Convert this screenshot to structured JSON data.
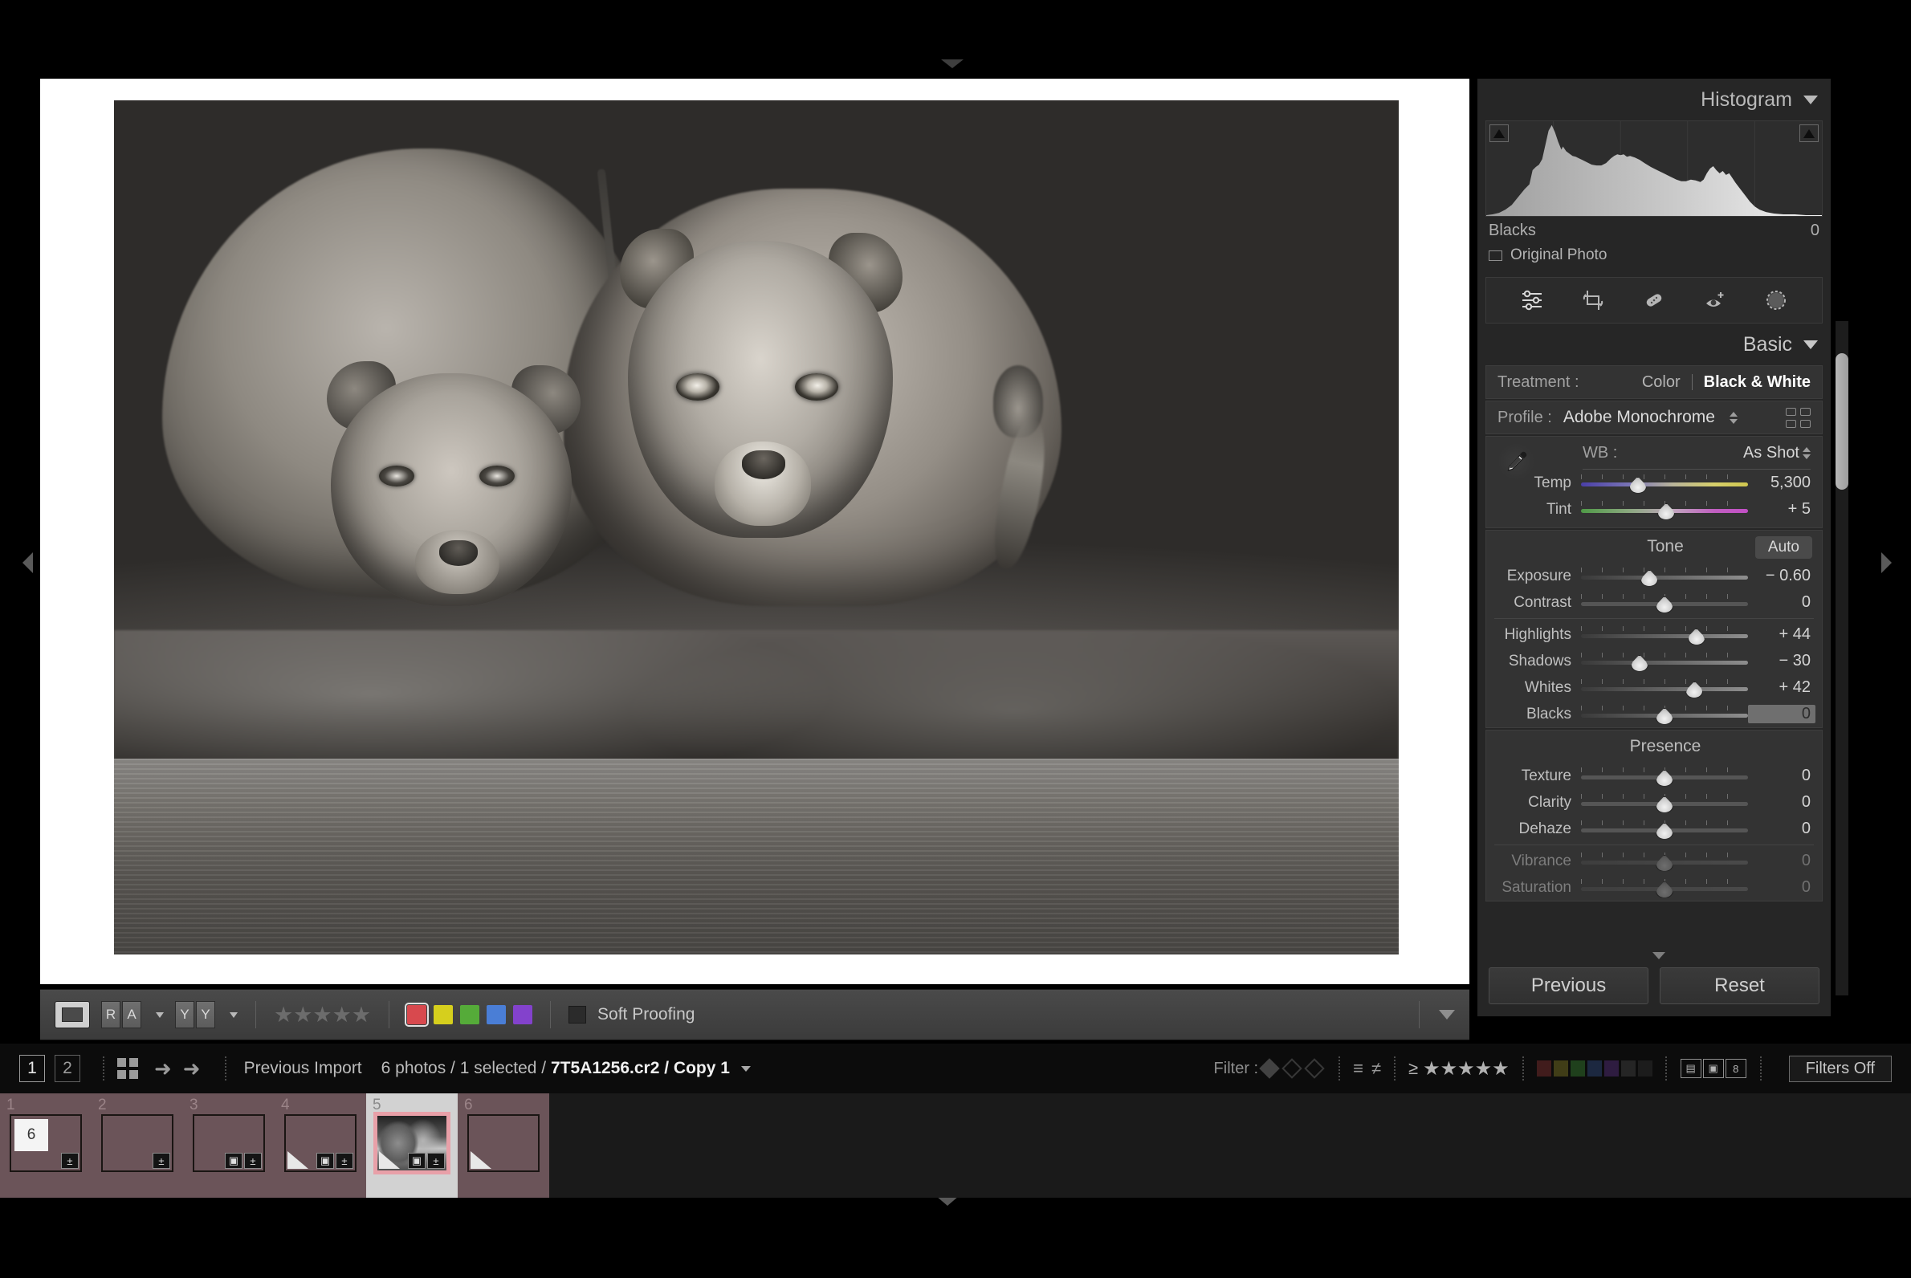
{
  "right_panel": {
    "histogram": {
      "title": "Histogram",
      "collapse_icon": "chevron-down-icon",
      "readout_label": "Blacks",
      "readout_value": "0",
      "original_photo_label": "Original Photo",
      "clip_left_icon": "shadow-clipping-triangle-icon",
      "clip_right_icon": "highlight-clipping-triangle-icon"
    },
    "tools": [
      {
        "name": "edit-sliders-icon",
        "title": "Edit"
      },
      {
        "name": "crop-overlay-icon",
        "title": "Crop"
      },
      {
        "name": "spot-removal-icon",
        "title": "Healing"
      },
      {
        "name": "red-eye-icon",
        "title": "Red Eye"
      },
      {
        "name": "masking-icon",
        "title": "Masking"
      }
    ],
    "basic": {
      "title": "Basic",
      "collapse_icon": "chevron-down-icon",
      "treatment_label": "Treatment :",
      "treatment_options": [
        "Color",
        "Black & White"
      ],
      "treatment_selected": "Black & White",
      "profile_label": "Profile :",
      "profile_value": "Adobe Monochrome",
      "profile_browser_icon": "grid-2x2-icon",
      "wb_label": "WB :",
      "wb_value": "As Shot",
      "eyedropper_icon": "eyedropper-icon",
      "white_balance_sliders": [
        {
          "label": "Temp",
          "value": "5,300",
          "pos": 34,
          "style": "temp",
          "dim": false
        },
        {
          "label": "Tint",
          "value": "+ 5",
          "pos": 51,
          "style": "tint",
          "dim": false
        }
      ],
      "tone_title": "Tone",
      "auto_label": "Auto",
      "tone_sliders": [
        {
          "label": "Exposure",
          "value": "− 0.60",
          "pos": 41,
          "style": "tonal",
          "dim": false
        },
        {
          "label": "Contrast",
          "value": "0",
          "pos": 50,
          "style": "flat",
          "dim": false
        },
        {
          "label": "Highlights",
          "value": "+ 44",
          "pos": 69,
          "style": "tonal",
          "dim": false
        },
        {
          "label": "Shadows",
          "value": "− 30",
          "pos": 35,
          "style": "tonal",
          "dim": false
        },
        {
          "label": "Whites",
          "value": "+ 42",
          "pos": 68,
          "style": "tonal",
          "dim": false
        },
        {
          "label": "Blacks",
          "value": "0",
          "pos": 50,
          "style": "tonal",
          "dim": false,
          "boxed": true
        }
      ],
      "presence_title": "Presence",
      "presence_sliders": [
        {
          "label": "Texture",
          "value": "0",
          "pos": 50,
          "style": "flat",
          "dim": false
        },
        {
          "label": "Clarity",
          "value": "0",
          "pos": 50,
          "style": "flat",
          "dim": false
        },
        {
          "label": "Dehaze",
          "value": "0",
          "pos": 50,
          "style": "flat",
          "dim": false
        },
        {
          "label": "Vibrance",
          "value": "0",
          "pos": 50,
          "style": "dimmed",
          "dim": true
        },
        {
          "label": "Saturation",
          "value": "0",
          "pos": 50,
          "style": "dimmed",
          "dim": true
        }
      ]
    },
    "footer": {
      "previous_label": "Previous",
      "reset_label": "Reset"
    }
  },
  "image_toolbar": {
    "loupe_icon": "loupe-view-icon",
    "flag_pair": [
      "R",
      "A"
    ],
    "compare_pair": [
      "Y",
      "Y"
    ],
    "stars": "★★★★★",
    "color_swatches": [
      {
        "name": "red-label",
        "hex": "#d8494e",
        "selected": true
      },
      {
        "name": "yellow-label",
        "hex": "#d6cf1d",
        "selected": false
      },
      {
        "name": "green-label",
        "hex": "#55ab39",
        "selected": false
      },
      {
        "name": "blue-label",
        "hex": "#4a7ed6",
        "selected": false
      },
      {
        "name": "purple-label",
        "hex": "#8342cc",
        "selected": false
      }
    ],
    "soft_proofing_label": "Soft Proofing",
    "soft_proofing_checked": false,
    "toolbar_caret_icon": "chevron-down-icon"
  },
  "filmstrip_bar": {
    "view_1": "1",
    "view_2": "2",
    "grid_icon": "grid-view-icon",
    "back_icon": "arrow-left-icon",
    "forward_icon": "arrow-right-icon",
    "source": "Previous Import",
    "count_text": "6 photos / 1 selected /",
    "filename": "7T5A1256.cr2 / Copy 1",
    "filter_label": "Filter :",
    "filter_stars_prefix": "≥",
    "filter_stars": "★★★★★",
    "filter_colors": [
      "#6e2a2a",
      "#6b6620",
      "#2f6b2a",
      "#2a3f6b",
      "#4a2a6b",
      "#3a3a3a",
      "#2a2a2a"
    ],
    "view_icons": [
      "metadata-view-icon",
      "loupe-view-icon",
      "numbers-view-icon"
    ],
    "filters_off_label": "Filters Off"
  },
  "filmstrip": {
    "thumbnails": [
      {
        "num": "1",
        "mono": false,
        "selected": false,
        "badges": [
          "±"
        ],
        "has_corner_flag": false,
        "overlay_number": "6"
      },
      {
        "num": "2",
        "mono": false,
        "selected": false,
        "badges": [
          "±"
        ],
        "has_corner_flag": false,
        "overlay_number": ""
      },
      {
        "num": "3",
        "mono": false,
        "selected": false,
        "badges": [
          "▣",
          "±"
        ],
        "has_corner_flag": false,
        "overlay_number": ""
      },
      {
        "num": "4",
        "mono": false,
        "selected": false,
        "badges": [
          "▣",
          "±"
        ],
        "has_corner_flag": true,
        "overlay_number": ""
      },
      {
        "num": "5",
        "mono": true,
        "selected": true,
        "badges": [
          "▣",
          "±"
        ],
        "has_corner_flag": true,
        "overlay_number": ""
      },
      {
        "num": "6",
        "mono": false,
        "selected": false,
        "badges": [],
        "has_corner_flag": true,
        "overlay_number": ""
      }
    ]
  },
  "chrome": {
    "left_collapse_icon": "triangle-left-icon",
    "right_collapse_icon": "triangle-right-icon",
    "top_collapse_icon": "triangle-down-icon",
    "bottom_collapse_icon": "triangle-down-icon",
    "scrollbar_icon": "vertical-scrollbar"
  },
  "colors": {
    "panel_bg": "#262626",
    "block_bg": "#333333",
    "accent_selected": "#e8a0a8",
    "toolbar_bg": "#434343"
  }
}
